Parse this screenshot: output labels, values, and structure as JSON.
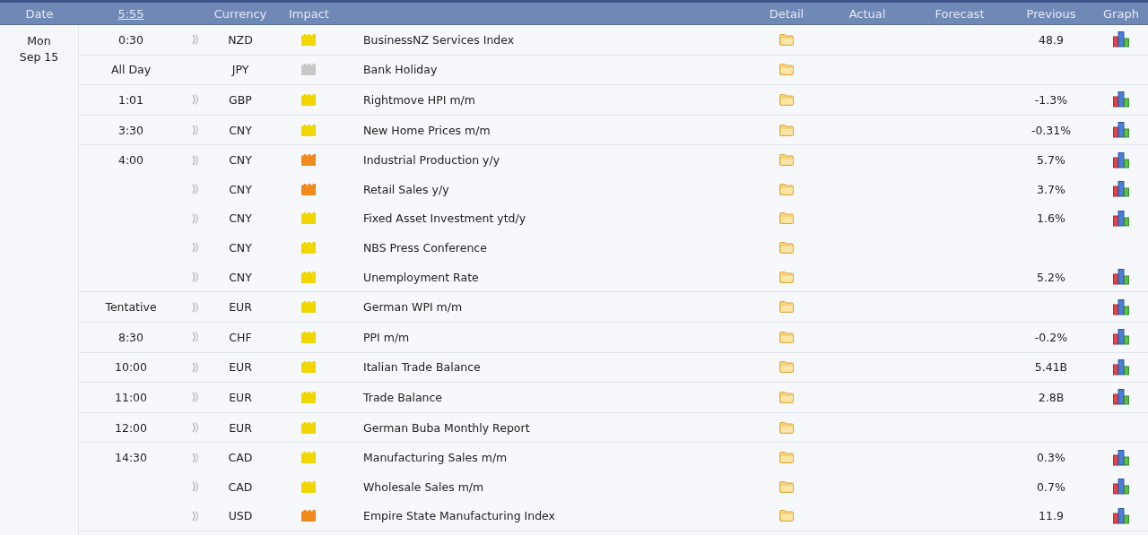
{
  "header": {
    "columns": [
      {
        "label": "Date",
        "kind": "text"
      },
      {
        "label": "5:55",
        "kind": "link"
      },
      {
        "kind": "blank"
      },
      {
        "label": "Currency",
        "kind": "text"
      },
      {
        "label": "Impact",
        "kind": "text"
      },
      {
        "kind": "blank"
      },
      {
        "label": "Detail",
        "kind": "text"
      },
      {
        "label": "Actual",
        "kind": "text"
      },
      {
        "label": "Forecast",
        "kind": "text"
      },
      {
        "label": "Previous",
        "kind": "text"
      },
      {
        "label": "Graph",
        "kind": "text"
      }
    ]
  },
  "day": {
    "weekday": "Mon",
    "date": "Sep 15"
  },
  "groups": [
    {
      "time": "0:30",
      "events": [
        {
          "currency": "NZD",
          "color": "#f2d600",
          "sound": true,
          "title": "BusinessNZ Services Index",
          "previous": "48.9",
          "graph": true
        }
      ]
    },
    {
      "time": "All Day",
      "events": [
        {
          "currency": "JPY",
          "color": "#c8c8c8",
          "sound": false,
          "title": "Bank Holiday",
          "graph": false
        }
      ]
    },
    {
      "time": "1:01",
      "events": [
        {
          "currency": "GBP",
          "color": "#f2d600",
          "sound": true,
          "title": "Rightmove HPI m/m",
          "previous": "-1.3%",
          "graph": true
        }
      ]
    },
    {
      "time": "3:30",
      "events": [
        {
          "currency": "CNY",
          "color": "#f2d600",
          "sound": true,
          "title": "New Home Prices m/m",
          "previous": "-0.31%",
          "graph": true
        }
      ]
    },
    {
      "time": "4:00",
      "events": [
        {
          "currency": "CNY",
          "color": "#f08a1c",
          "sound": true,
          "title": "Industrial Production y/y",
          "previous": "5.7%",
          "graph": true
        },
        {
          "currency": "CNY",
          "color": "#f08a1c",
          "sound": true,
          "title": "Retail Sales y/y",
          "previous": "3.7%",
          "graph": true
        },
        {
          "currency": "CNY",
          "color": "#f2d600",
          "sound": true,
          "title": "Fixed Asset Investment ytd/y",
          "previous": "1.6%",
          "graph": true
        },
        {
          "currency": "CNY",
          "color": "#f2d600",
          "sound": true,
          "title": "NBS Press Conference",
          "graph": false
        },
        {
          "currency": "CNY",
          "color": "#f2d600",
          "sound": true,
          "title": "Unemployment Rate",
          "previous": "5.2%",
          "graph": true
        }
      ]
    },
    {
      "time": "Tentative",
      "events": [
        {
          "currency": "EUR",
          "color": "#f2d600",
          "sound": true,
          "title": "German WPI m/m",
          "graph": true
        }
      ]
    },
    {
      "time": "8:30",
      "events": [
        {
          "currency": "CHF",
          "color": "#f2d600",
          "sound": true,
          "title": "PPI m/m",
          "previous": "-0.2%",
          "graph": true
        }
      ]
    },
    {
      "time": "10:00",
      "events": [
        {
          "currency": "EUR",
          "color": "#f2d600",
          "sound": true,
          "title": "Italian Trade Balance",
          "previous": "5.41B",
          "graph": true
        }
      ]
    },
    {
      "time": "11:00",
      "events": [
        {
          "currency": "EUR",
          "color": "#f2d600",
          "sound": true,
          "title": "Trade Balance",
          "previous": "2.8B",
          "graph": true
        }
      ]
    },
    {
      "time": "12:00",
      "events": [
        {
          "currency": "EUR",
          "color": "#f2d600",
          "sound": true,
          "title": "German Buba Monthly Report",
          "graph": false
        }
      ]
    },
    {
      "time": "14:30",
      "events": [
        {
          "currency": "CAD",
          "color": "#f2d600",
          "sound": true,
          "title": "Manufacturing Sales m/m",
          "previous": "0.3%",
          "graph": true
        },
        {
          "currency": "CAD",
          "color": "#f2d600",
          "sound": true,
          "title": "Wholesale Sales m/m",
          "previous": "0.7%",
          "graph": true
        },
        {
          "currency": "USD",
          "color": "#f08a1c",
          "sound": true,
          "title": "Empire State Manufacturing Index",
          "previous": "11.9",
          "graph": true
        }
      ]
    }
  ]
}
